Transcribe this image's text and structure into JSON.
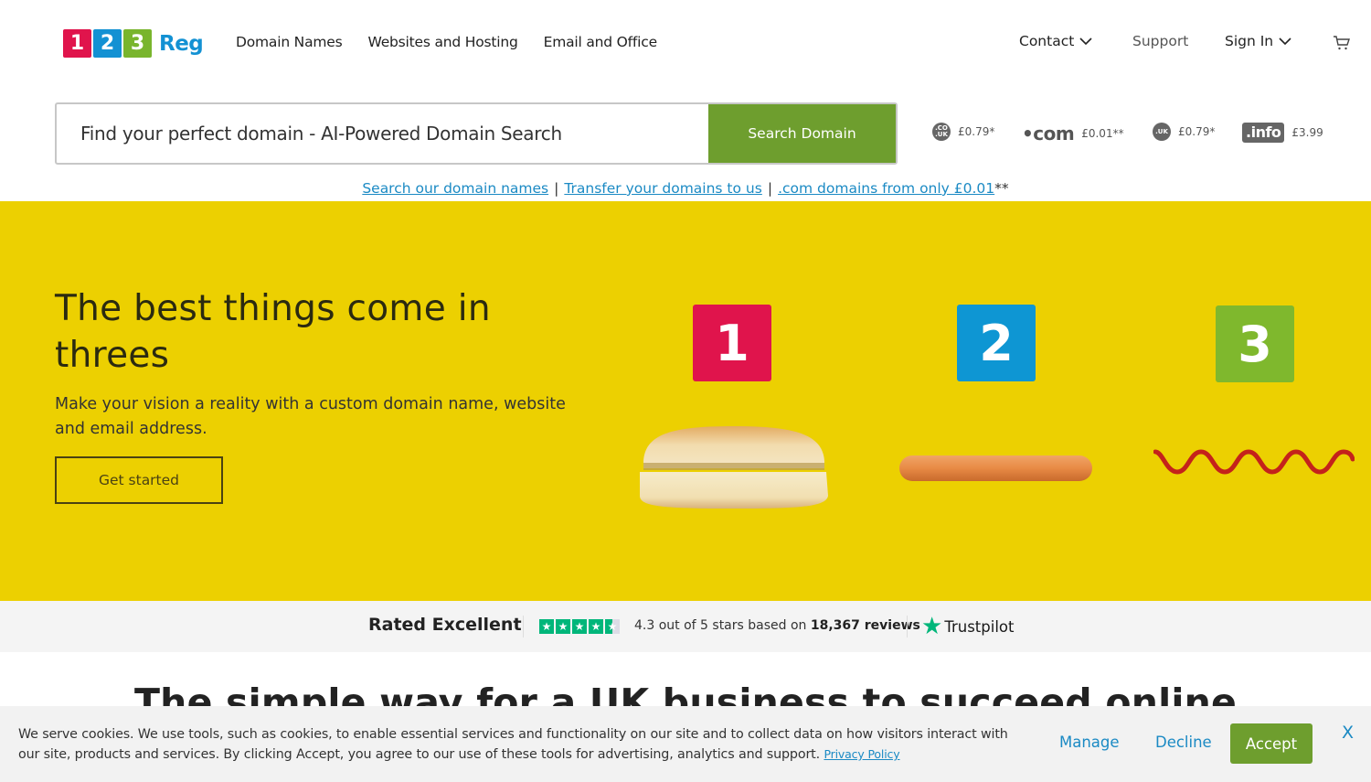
{
  "header": {
    "logo": {
      "digits": [
        "1",
        "2",
        "3"
      ],
      "text": "Reg"
    },
    "main_nav": [
      "Domain Names",
      "Websites and Hosting",
      "Email and Office"
    ],
    "contact": "Contact",
    "support": "Support",
    "sign_in": "Sign In",
    "cart_icon": "cart-icon"
  },
  "search": {
    "placeholder": "Find your perfect domain - AI-Powered Domain Search",
    "button": "Search Domain"
  },
  "tld_prices": [
    {
      "tld": ".co.uk",
      "badge": ".CO .UK",
      "price": "£0.79*"
    },
    {
      "tld": ".com",
      "badge": "•com",
      "price": "£0.01**"
    },
    {
      "tld": ".uk",
      "badge": ".UK",
      "price": "£0.79*"
    },
    {
      "tld": ".info",
      "badge": ".info",
      "price": "£3.99"
    }
  ],
  "quick_links": {
    "search": "Search our domain names",
    "transfer": "Transfer your domains to us",
    "com_offer": ".com domains from only £0.01",
    "separator": "|",
    "suffix": "**"
  },
  "hero": {
    "title": "The best things come in threes",
    "subtitle": "Make your vision a reality with a custom domain name, website and email address.",
    "cta": "Get started",
    "badges": [
      "1",
      "2",
      "3"
    ],
    "colors": {
      "background": "#ecd001",
      "one": "#e0144c",
      "two": "#0e96d3",
      "three": "#7fb82d"
    }
  },
  "trust": {
    "rated": "Rated Excellent",
    "rating": 4.3,
    "max_rating": 5,
    "summary_prefix": "4.3 out of 5 stars based on ",
    "review_count": "18,367 reviews",
    "brand": "Trustpilot",
    "star_glyph": "★"
  },
  "next_section": {
    "heading": "The simple way for a UK business to succeed online"
  },
  "cookie_banner": {
    "text": "We serve cookies. We use tools, such as cookies, to enable essential services and functionality on our site and to collect data on how visitors interact with our site, products and services. By clicking Accept, you agree to our use of these tools for advertising, analytics and support. ",
    "privacy_link": "Privacy Policy",
    "manage": "Manage",
    "decline": "Decline",
    "accept": "Accept",
    "close": "X"
  },
  "colors": {
    "brand_green": "#6e9e2e",
    "link_blue": "#1b8ac4",
    "trustpilot_green": "#00b67a"
  }
}
